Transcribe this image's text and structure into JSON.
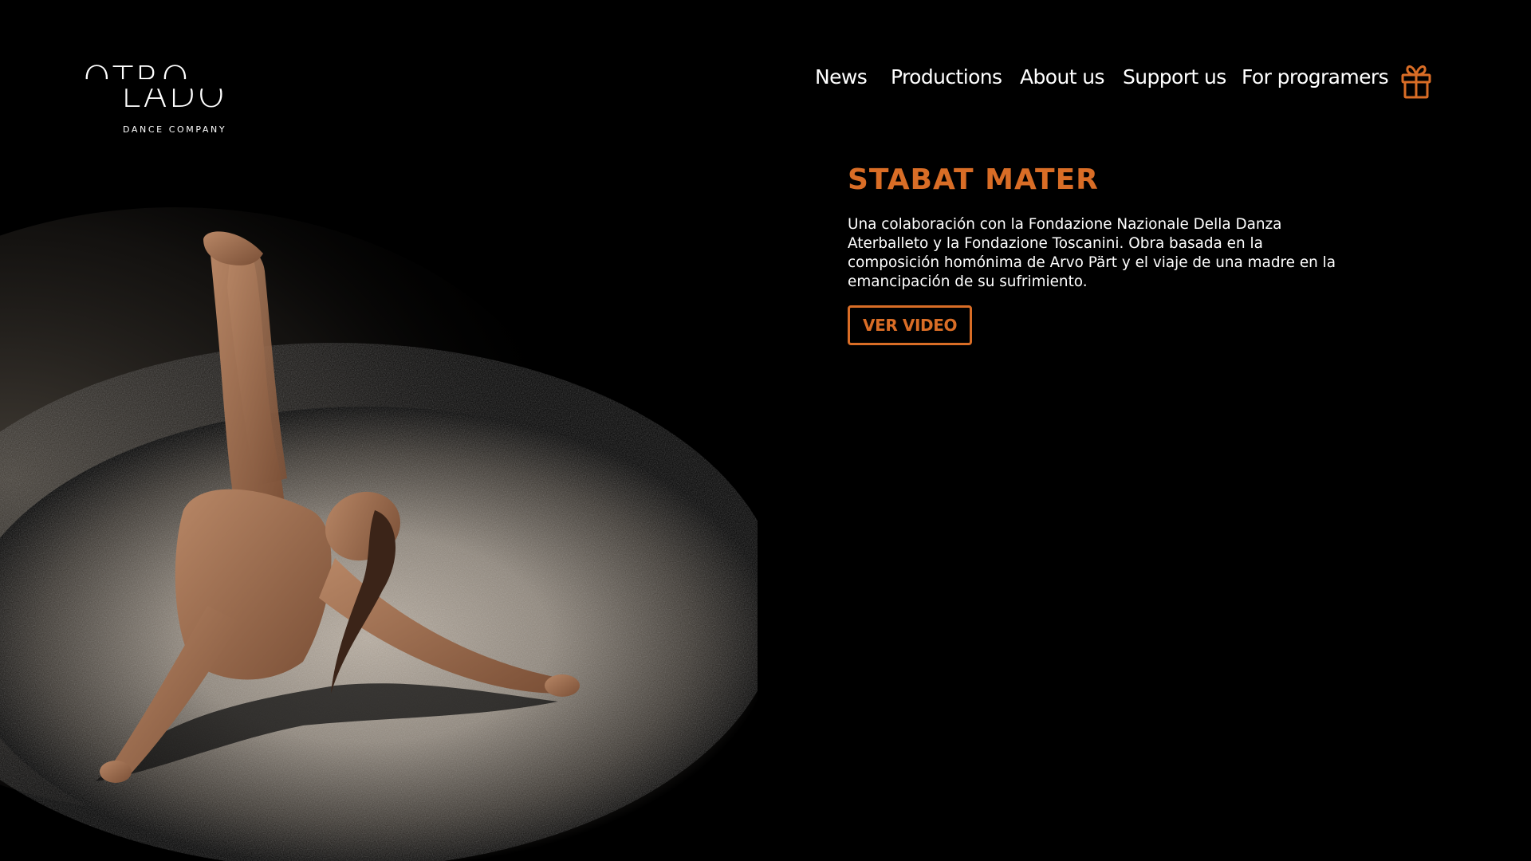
{
  "brand": {
    "logo_line1": "OTRO",
    "logo_line2": "LADO",
    "logo_sub": "DANCE COMPANY"
  },
  "nav": {
    "items": [
      {
        "label": "News"
      },
      {
        "label": "Productions"
      },
      {
        "label": "About us"
      },
      {
        "label": "Support us"
      },
      {
        "label": "For programers"
      }
    ],
    "gift_icon": "gift-icon"
  },
  "feature": {
    "title": "STABAT MATER",
    "description": "Una colaboración con la Fondazione Nazionale Della Danza Aterballeto y la Fondazione Toscanini. Obra basada en la composición homónima de Arvo Pärt y el viaje de una madre en la emancipación de su sufrimiento.",
    "button_label": "VER VIDEO"
  },
  "hero": {
    "image": "dancer-on-stage-photo"
  },
  "colors": {
    "accent": "#d96d26",
    "background": "#000000",
    "text": "#ffffff"
  }
}
